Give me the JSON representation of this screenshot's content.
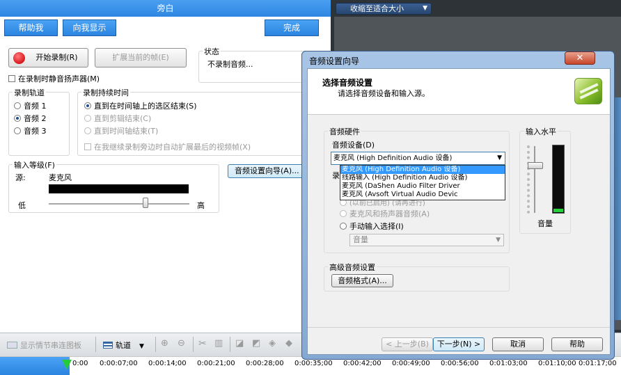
{
  "narration": {
    "title": "旁白",
    "help_button": "帮助我",
    "show_me_button": "向我显示",
    "done_button": "完成",
    "start_record_button": "开始录制(R)",
    "extend_frame_button": "扩展当前的帧(E)",
    "status_group": "状态",
    "status_text": "不录制音频...",
    "mute_speakers_label": "在录制时静音扬声器(M)",
    "track_group": "录制轨道",
    "tracks": [
      "音频 1",
      "音频 2",
      "音频 3"
    ],
    "duration_group": "录制持续时间",
    "duration_options": [
      "直到在时间轴上的选区结束(S)",
      "直到剪辑结束(C)",
      "直到时间轴结束(T)"
    ],
    "auto_extend_label": "在我继续录制旁边时自动扩展最后的视频帧(X)",
    "input_level_group": "输入等级(F)",
    "source_label": "源:",
    "source_value": "麦克风",
    "low_label": "低",
    "high_label": "高",
    "audio_wizard_button": "音频设置向导(A)..."
  },
  "preview": {
    "fit_dropdown": "收缩至适合大小"
  },
  "toolbar": {
    "storyboard_button": "显示情节串连图板",
    "track_dropdown": "轨道"
  },
  "timeline": {
    "ticks": [
      "0:00",
      "0:00:07;00",
      "0:00:14;00",
      "0:00:21;00",
      "0:00:28;00",
      "0:00:35;00",
      "0:00:42;00",
      "0:00:49;00",
      "0:00:56;00",
      "0:01:03;00",
      "0:01:10;00",
      "0:01:17;00"
    ]
  },
  "dialog": {
    "title": "音频设置向导",
    "close_label": "✕",
    "heading": "选择音频设置",
    "subheading": "请选择音频设备和输入源。",
    "hardware_group": "音频硬件",
    "device_label": "音频设备(D)",
    "device_value": "麦克风 (High Definition Audio 设备)",
    "device_options": [
      "麦克风 (High Definition Audio 设备)",
      "线路输入 (High Definition Audio 设备)",
      "麦克风 (DaShen Audio Filter Driver",
      "麦克风 (Avsoft Virtual Audio Devic"
    ],
    "source_label_partial": "录",
    "hidden_option_partial": "(以前已启用) (请再进行)",
    "mic_speaker_option": "麦克风和扬声器音频(A)",
    "manual_option": "手动输入选择(I)",
    "volume_select": "音量",
    "input_level_group": "输入水平",
    "volume_label": "音量",
    "advanced_group": "高级音频设置",
    "audio_format_button": "音频格式(A)...",
    "back_button": "< 上一步(B)",
    "next_button": "下一步(N) >",
    "cancel_button": "取消",
    "help_button": "帮助"
  },
  "colors": {
    "accent_blue": "#2b84df",
    "record_red": "#e0242a",
    "meter_green": "#25d13a"
  }
}
